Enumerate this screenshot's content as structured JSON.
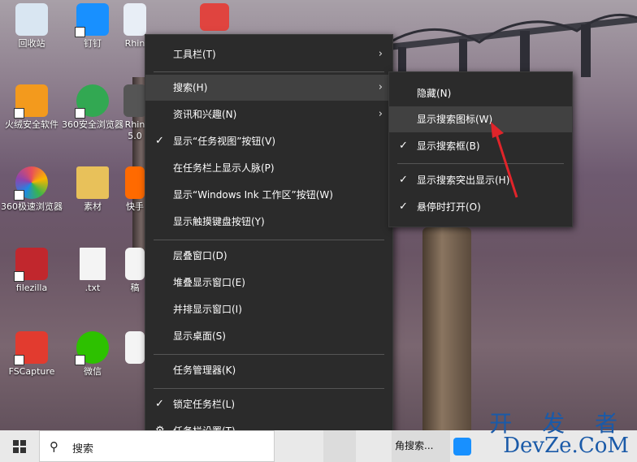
{
  "desktop": {
    "icons": [
      {
        "label": "回收站",
        "icon": "recycle-bin-icon",
        "color": "#d9e6f2"
      },
      {
        "label": "钉钉",
        "icon": "dingtalk-icon",
        "color": "#1890ff"
      },
      {
        "label": "Rhin",
        "icon": "rhino-icon",
        "color": "#e8eef6"
      },
      {
        "label": "火绒安全软件",
        "icon": "huorong-icon",
        "color": "#f39a1d"
      },
      {
        "label": "360安全浏览器",
        "icon": "360-browser-icon",
        "color": "#32a852"
      },
      {
        "label": "Rhin 5.0",
        "icon": "rhino5-icon",
        "color": "#555555"
      },
      {
        "label": "360极速浏览器",
        "icon": "360-speed-browser-icon",
        "color": "#e84f5a"
      },
      {
        "label": "素材",
        "icon": "folder-icon",
        "color": "#e8c15a"
      },
      {
        "label": "快手",
        "icon": "kuaishou-icon",
        "color": "#ff6a00"
      },
      {
        "label": "filezilla",
        "icon": "filezilla-icon",
        "color": "#c1272d"
      },
      {
        "label": ".txt",
        "icon": "text-file-icon",
        "color": "#f4f4f4"
      },
      {
        "label": "稿",
        "icon": "document-icon",
        "color": "#f4f4f4"
      },
      {
        "label": "FSCapture",
        "icon": "fscapture-icon",
        "color": "#e23b2f"
      },
      {
        "label": "微信",
        "icon": "wechat-icon",
        "color": "#2dc100"
      },
      {
        "label": "",
        "icon": "doc-icon",
        "color": "#f4f4f4"
      },
      {
        "label": "",
        "icon": "pdf-icon",
        "color": "#e0443f"
      }
    ]
  },
  "context_menu": {
    "items": [
      {
        "label": "工具栏(T)",
        "check": "",
        "arrow": "›"
      },
      {
        "label": "搜索(H)",
        "check": "",
        "arrow": "›"
      },
      {
        "label": "资讯和兴趣(N)",
        "check": "",
        "arrow": "›"
      },
      {
        "label": "显示“任务视图”按钮(V)",
        "check": "✓",
        "arrow": ""
      },
      {
        "label": "在任务栏上显示人脉(P)",
        "check": "",
        "arrow": ""
      },
      {
        "label": "显示“Windows Ink 工作区”按钮(W)",
        "check": "",
        "arrow": ""
      },
      {
        "label": "显示触摸键盘按钮(Y)",
        "check": "",
        "arrow": ""
      },
      {
        "label": "层叠窗口(D)",
        "check": "",
        "arrow": ""
      },
      {
        "label": "堆叠显示窗口(E)",
        "check": "",
        "arrow": ""
      },
      {
        "label": "并排显示窗口(I)",
        "check": "",
        "arrow": ""
      },
      {
        "label": "显示桌面(S)",
        "check": "",
        "arrow": ""
      },
      {
        "label": "任务管理器(K)",
        "check": "",
        "arrow": ""
      },
      {
        "label": "锁定任务栏(L)",
        "check": "✓",
        "arrow": ""
      },
      {
        "label": "任务栏设置(T)",
        "check": "⚙",
        "arrow": ""
      }
    ]
  },
  "search_submenu": {
    "items": [
      {
        "label": "隐藏(N)",
        "check": ""
      },
      {
        "label": "显示搜索图标(W)",
        "check": ""
      },
      {
        "label": "显示搜索框(B)",
        "check": "✓"
      },
      {
        "label": "显示搜索突出显示(H)",
        "check": "✓"
      },
      {
        "label": "悬停时打开(O)",
        "check": "✓"
      }
    ]
  },
  "taskbar": {
    "search_icon": "⚲",
    "search_text": "搜索",
    "app_label": "角搜索..."
  },
  "watermark": {
    "line1": "开 发 者",
    "line2": "DevZe.CoM"
  },
  "colors": {
    "menu_bg": "#2b2b2b",
    "menu_highlight": "#414141",
    "arrow_red": "#e0242a"
  }
}
